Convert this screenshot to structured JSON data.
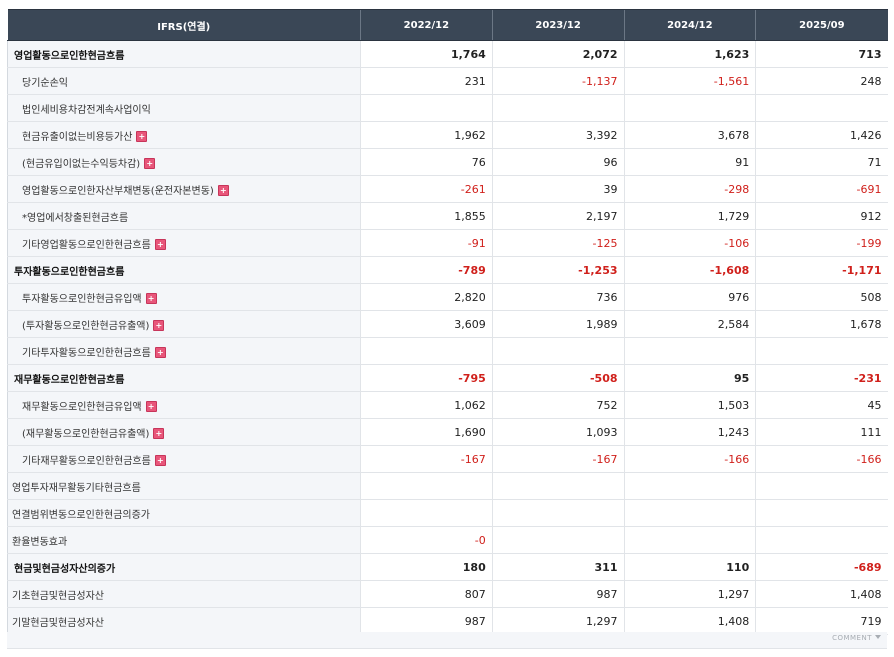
{
  "header": {
    "label_col": "IFRS(연결)",
    "periods": [
      "2022/12",
      "2023/12",
      "2024/12",
      "2025/09"
    ]
  },
  "rows": [
    {
      "label": "영업활동으로인한현금흐름",
      "kind": "main",
      "plus": false,
      "values": [
        "1,764",
        "2,072",
        "1,623",
        "713"
      ]
    },
    {
      "label": "당기순손익",
      "kind": "sub",
      "plus": false,
      "values": [
        "231",
        "-1,137",
        "-1,561",
        "248"
      ]
    },
    {
      "label": "법인세비용차감전계속사업이익",
      "kind": "sub",
      "plus": false,
      "values": [
        "",
        "",
        "",
        ""
      ]
    },
    {
      "label": "현금유출이없는비용등가산",
      "kind": "sub",
      "plus": true,
      "values": [
        "1,962",
        "3,392",
        "3,678",
        "1,426"
      ]
    },
    {
      "label": "(현금유입이없는수익등차감)",
      "kind": "sub",
      "plus": true,
      "values": [
        "76",
        "96",
        "91",
        "71"
      ]
    },
    {
      "label": "영업활동으로인한자산부채변동(운전자본변동)",
      "kind": "sub",
      "plus": true,
      "values": [
        "-261",
        "39",
        "-298",
        "-691"
      ]
    },
    {
      "label": "*영업에서창출된현금흐름",
      "kind": "sub",
      "plus": false,
      "values": [
        "1,855",
        "2,197",
        "1,729",
        "912"
      ]
    },
    {
      "label": "기타영업활동으로인한현금흐름",
      "kind": "sub",
      "plus": true,
      "values": [
        "-91",
        "-125",
        "-106",
        "-199"
      ]
    },
    {
      "label": "투자활동으로인한현금흐름",
      "kind": "main",
      "plus": false,
      "values": [
        "-789",
        "-1,253",
        "-1,608",
        "-1,171"
      ]
    },
    {
      "label": "투자활동으로인한현금유입액",
      "kind": "sub",
      "plus": true,
      "values": [
        "2,820",
        "736",
        "976",
        "508"
      ]
    },
    {
      "label": "(투자활동으로인한현금유출액)",
      "kind": "sub",
      "plus": true,
      "values": [
        "3,609",
        "1,989",
        "2,584",
        "1,678"
      ]
    },
    {
      "label": "기타투자활동으로인한현금흐름",
      "kind": "sub",
      "plus": true,
      "values": [
        "",
        "",
        "",
        ""
      ]
    },
    {
      "label": "재무활동으로인한현금흐름",
      "kind": "main",
      "plus": false,
      "values": [
        "-795",
        "-508",
        "95",
        "-231"
      ]
    },
    {
      "label": "재무활동으로인한현금유입액",
      "kind": "sub",
      "plus": true,
      "values": [
        "1,062",
        "752",
        "1,503",
        "45"
      ]
    },
    {
      "label": "(재무활동으로인한현금유출액)",
      "kind": "sub",
      "plus": true,
      "values": [
        "1,690",
        "1,093",
        "1,243",
        "111"
      ]
    },
    {
      "label": "기타재무활동으로인한현금흐름",
      "kind": "sub",
      "plus": true,
      "values": [
        "-167",
        "-167",
        "-166",
        "-166"
      ]
    },
    {
      "label": "영업투자재무활동기타현금흐름",
      "kind": "plain",
      "plus": false,
      "values": [
        "",
        "",
        "",
        ""
      ]
    },
    {
      "label": "연결범위변동으로인한현금의증가",
      "kind": "plain",
      "plus": false,
      "values": [
        "",
        "",
        "",
        ""
      ]
    },
    {
      "label": "환율변동효과",
      "kind": "plain",
      "plus": false,
      "values": [
        "-0",
        "",
        "",
        ""
      ]
    },
    {
      "label": "현금및현금성자산의증가",
      "kind": "main",
      "plus": false,
      "values": [
        "180",
        "311",
        "110",
        "-689"
      ]
    },
    {
      "label": "기초현금및현금성자산",
      "kind": "plain",
      "plus": false,
      "values": [
        "807",
        "987",
        "1,297",
        "1,408"
      ]
    },
    {
      "label": "기말현금및현금성자산",
      "kind": "plain",
      "plus": false,
      "values": [
        "987",
        "1,297",
        "1,408",
        "719"
      ]
    }
  ],
  "footer": {
    "comment_label": "COMMENT"
  },
  "colors": {
    "header_bg": "#3a4756",
    "negative": "#d0201b",
    "plus_icon": "#e8567a"
  },
  "icons": {
    "expand": "plus-icon",
    "comment_toggle": "caret-down-icon"
  }
}
